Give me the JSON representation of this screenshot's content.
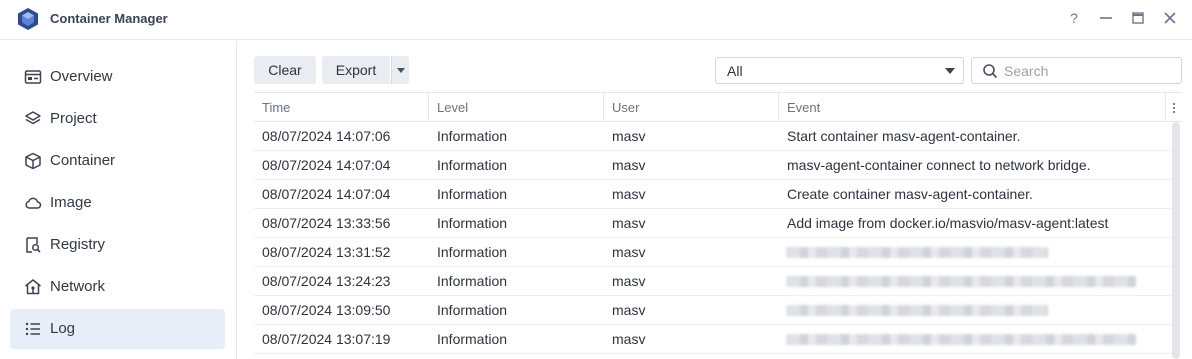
{
  "window": {
    "title": "Container Manager",
    "controls": {
      "help": "?",
      "minimize": "—",
      "maximize": "▭",
      "close": "✕"
    }
  },
  "sidebar": {
    "items": [
      {
        "label": "Overview",
        "icon": "overview-icon"
      },
      {
        "label": "Project",
        "icon": "layers-icon"
      },
      {
        "label": "Container",
        "icon": "cube-icon"
      },
      {
        "label": "Image",
        "icon": "cloud-icon"
      },
      {
        "label": "Registry",
        "icon": "registry-search-icon"
      },
      {
        "label": "Network",
        "icon": "network-house-icon"
      },
      {
        "label": "Log",
        "icon": "list-icon",
        "active": true
      }
    ]
  },
  "toolbar": {
    "clear_label": "Clear",
    "export_label": "Export",
    "filter_value": "All",
    "search_placeholder": "Search"
  },
  "table": {
    "columns": [
      "Time",
      "Level",
      "User",
      "Event"
    ],
    "rows": [
      {
        "time": "08/07/2024 14:07:06",
        "level": "Information",
        "user": "masv",
        "event": "Start container masv-agent-container."
      },
      {
        "time": "08/07/2024 14:07:04",
        "level": "Information",
        "user": "masv",
        "event": "masv-agent-container connect to network bridge."
      },
      {
        "time": "08/07/2024 14:07:04",
        "level": "Information",
        "user": "masv",
        "event": "Create container masv-agent-container."
      },
      {
        "time": "08/07/2024 13:33:56",
        "level": "Information",
        "user": "masv",
        "event": "Add image from docker.io/masvio/masv-agent:latest"
      },
      {
        "time": "08/07/2024 13:31:52",
        "level": "Information",
        "user": "masv",
        "event": "",
        "redacted": true
      },
      {
        "time": "08/07/2024 13:24:23",
        "level": "Information",
        "user": "masv",
        "event": "",
        "redacted": true
      },
      {
        "time": "08/07/2024 13:09:50",
        "level": "Information",
        "user": "masv",
        "event": "",
        "redacted": true
      },
      {
        "time": "08/07/2024 13:07:19",
        "level": "Information",
        "user": "masv",
        "event": "",
        "redacted": true
      }
    ]
  },
  "colors": {
    "accent": "#3a6fd8",
    "active_nav_bg": "#e8eef8",
    "logo_bg": "#2f4b8a"
  }
}
